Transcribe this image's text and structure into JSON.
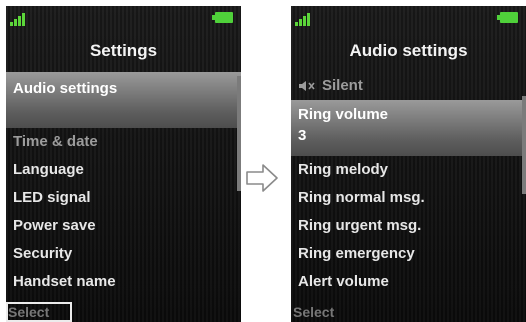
{
  "screens": [
    {
      "title": "Settings",
      "items": [
        "Audio settings",
        "Time & date",
        "Language",
        "LED signal",
        "Power save",
        "Security",
        "Handset name"
      ],
      "softkey": "Select"
    },
    {
      "title": "Audio settings",
      "items": [
        "Silent",
        "Ring volume",
        "Ring melody",
        "Ring normal msg.",
        "Ring urgent msg.",
        "Ring emergency",
        "Alert volume"
      ],
      "selected_value": "3",
      "softkey": "Select"
    }
  ],
  "icons": {
    "signal": "signal-bars-icon",
    "battery": "battery-icon",
    "mute": "speaker-mute-icon",
    "arrow": "right-arrow-icon"
  },
  "colors": {
    "signal": "#5cd63a",
    "battery": "#4fd13a",
    "highlight": "#7a7a7a"
  }
}
